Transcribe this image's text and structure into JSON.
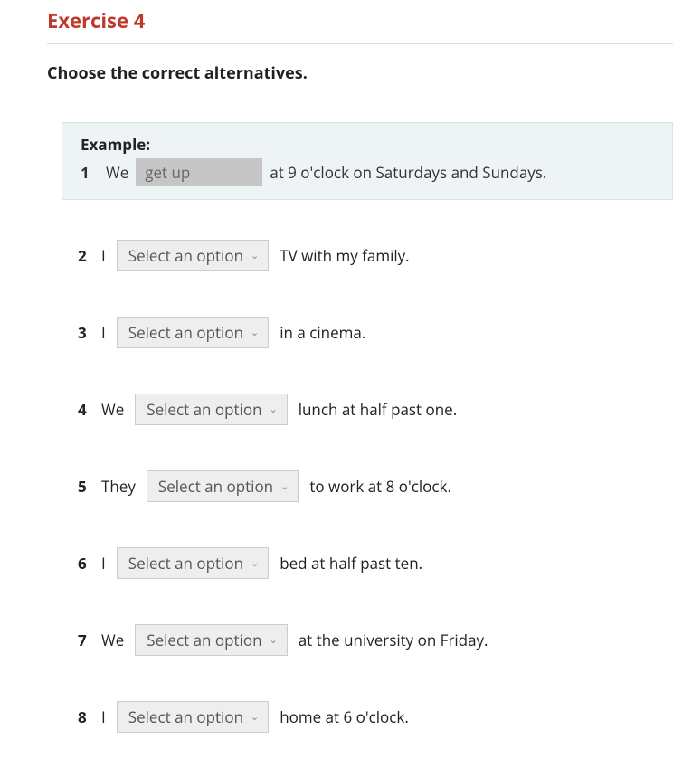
{
  "title": "Exercise 4",
  "instruction": "Choose the correct alternatives.",
  "example": {
    "label": "Example:",
    "number": "1",
    "before": "We",
    "answer": "get up",
    "after": "at 9 o'clock on Saturdays and Sundays."
  },
  "select_placeholder": "Select an option",
  "questions": [
    {
      "number": "2",
      "before": "I",
      "after": "TV with my family."
    },
    {
      "number": "3",
      "before": "I",
      "after": "in a cinema."
    },
    {
      "number": "4",
      "before": "We",
      "after": "lunch at half past one."
    },
    {
      "number": "5",
      "before": "They",
      "after": "to work at 8 o'clock."
    },
    {
      "number": "6",
      "before": "I",
      "after": "bed at half past ten."
    },
    {
      "number": "7",
      "before": "We",
      "after": "at the university on Friday."
    },
    {
      "number": "8",
      "before": "I",
      "after": "home at 6 o'clock."
    }
  ]
}
